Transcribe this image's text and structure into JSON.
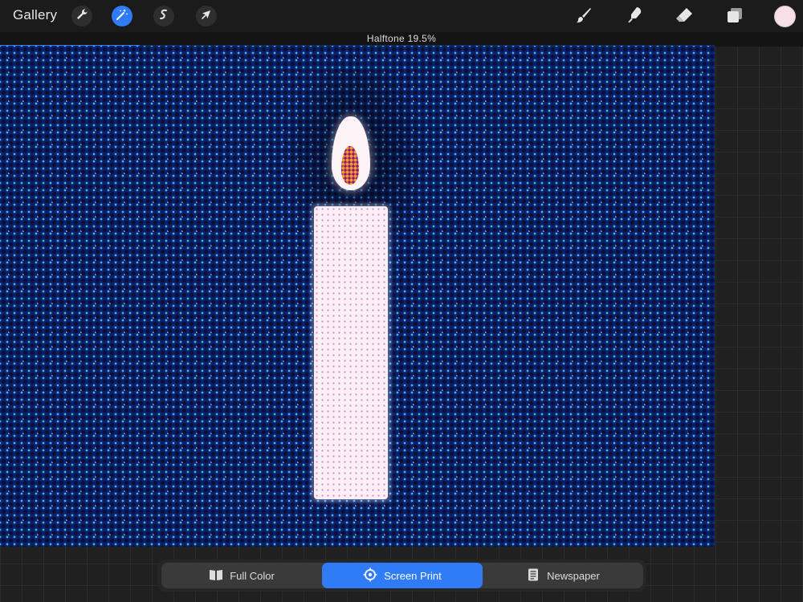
{
  "toolbar": {
    "gallery_label": "Gallery",
    "left_tools": [
      {
        "name": "actions",
        "icon": "wrench-icon"
      },
      {
        "name": "adjustments",
        "icon": "magic-wand-icon",
        "active": true
      },
      {
        "name": "selection",
        "icon": "selection-s-icon"
      },
      {
        "name": "transform",
        "icon": "cursor-arrow-icon"
      }
    ],
    "right_tools": [
      {
        "name": "brush",
        "icon": "brush-icon"
      },
      {
        "name": "smudge",
        "icon": "smudge-icon"
      },
      {
        "name": "eraser",
        "icon": "eraser-icon"
      },
      {
        "name": "layers",
        "icon": "layers-icon"
      }
    ],
    "current_color": "#f7dfe6"
  },
  "status": {
    "text": "Halftone 19.5%",
    "progress": 0.195
  },
  "colors": {
    "accent": "#2f7cf6",
    "canvas_base": "#0a1f6e"
  },
  "modes": {
    "items": [
      {
        "label": "Full Color",
        "icon": "book-open-icon",
        "active": false
      },
      {
        "label": "Screen Print",
        "icon": "target-icon",
        "active": true
      },
      {
        "label": "Newspaper",
        "icon": "newspaper-icon",
        "active": false
      }
    ]
  }
}
